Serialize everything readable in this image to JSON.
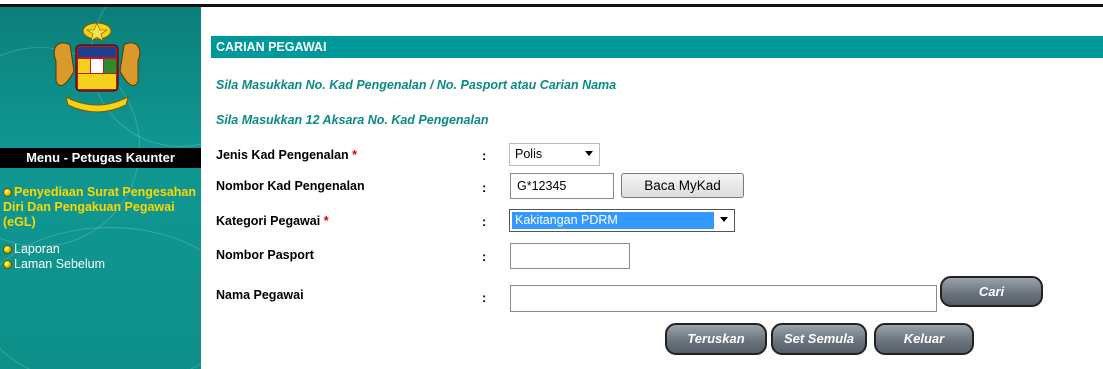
{
  "sidebar": {
    "menu_title": "Menu - Petugas Kaunter",
    "items": [
      {
        "label": "Penyediaan Surat Pengesahan Diri Dan Pengakuan Pegawai (eGL)"
      },
      {
        "label": "Laporan"
      },
      {
        "label": "Laman Sebelum"
      }
    ]
  },
  "main": {
    "header": "CARIAN PEGAWAI",
    "instruction_1": "Sila Masukkan No. Kad Pengenalan / No. Pasport atau Carian Nama",
    "instruction_2": "Sila Masukkan 12 Aksara No. Kad Pengenalan",
    "fields": {
      "jenis_kad": {
        "label": "Jenis Kad Pengenalan",
        "required": "*",
        "value": "Polis"
      },
      "nombor_kad": {
        "label": "Nombor Kad Pengenalan",
        "value": "G*12345",
        "button": "Baca MyKad"
      },
      "kategori": {
        "label": "Kategori Pegawai",
        "required": "*",
        "value": "Kakitangan PDRM"
      },
      "pasport": {
        "label": "Nombor Pasport",
        "value": ""
      },
      "nama": {
        "label": "Nama Pegawai",
        "value": "",
        "button": "Cari"
      }
    },
    "colon": ":",
    "actions": {
      "teruskan": "Teruskan",
      "set_semula": "Set Semula",
      "keluar": "Keluar"
    }
  },
  "colors": {
    "accent": "#009999",
    "sidebar": "#0e8f89",
    "link": "#ffd700",
    "instruction": "#0a8a86"
  },
  "icons": [
    "crest-logo",
    "bullet-icon",
    "dropdown-arrow-icon"
  ]
}
